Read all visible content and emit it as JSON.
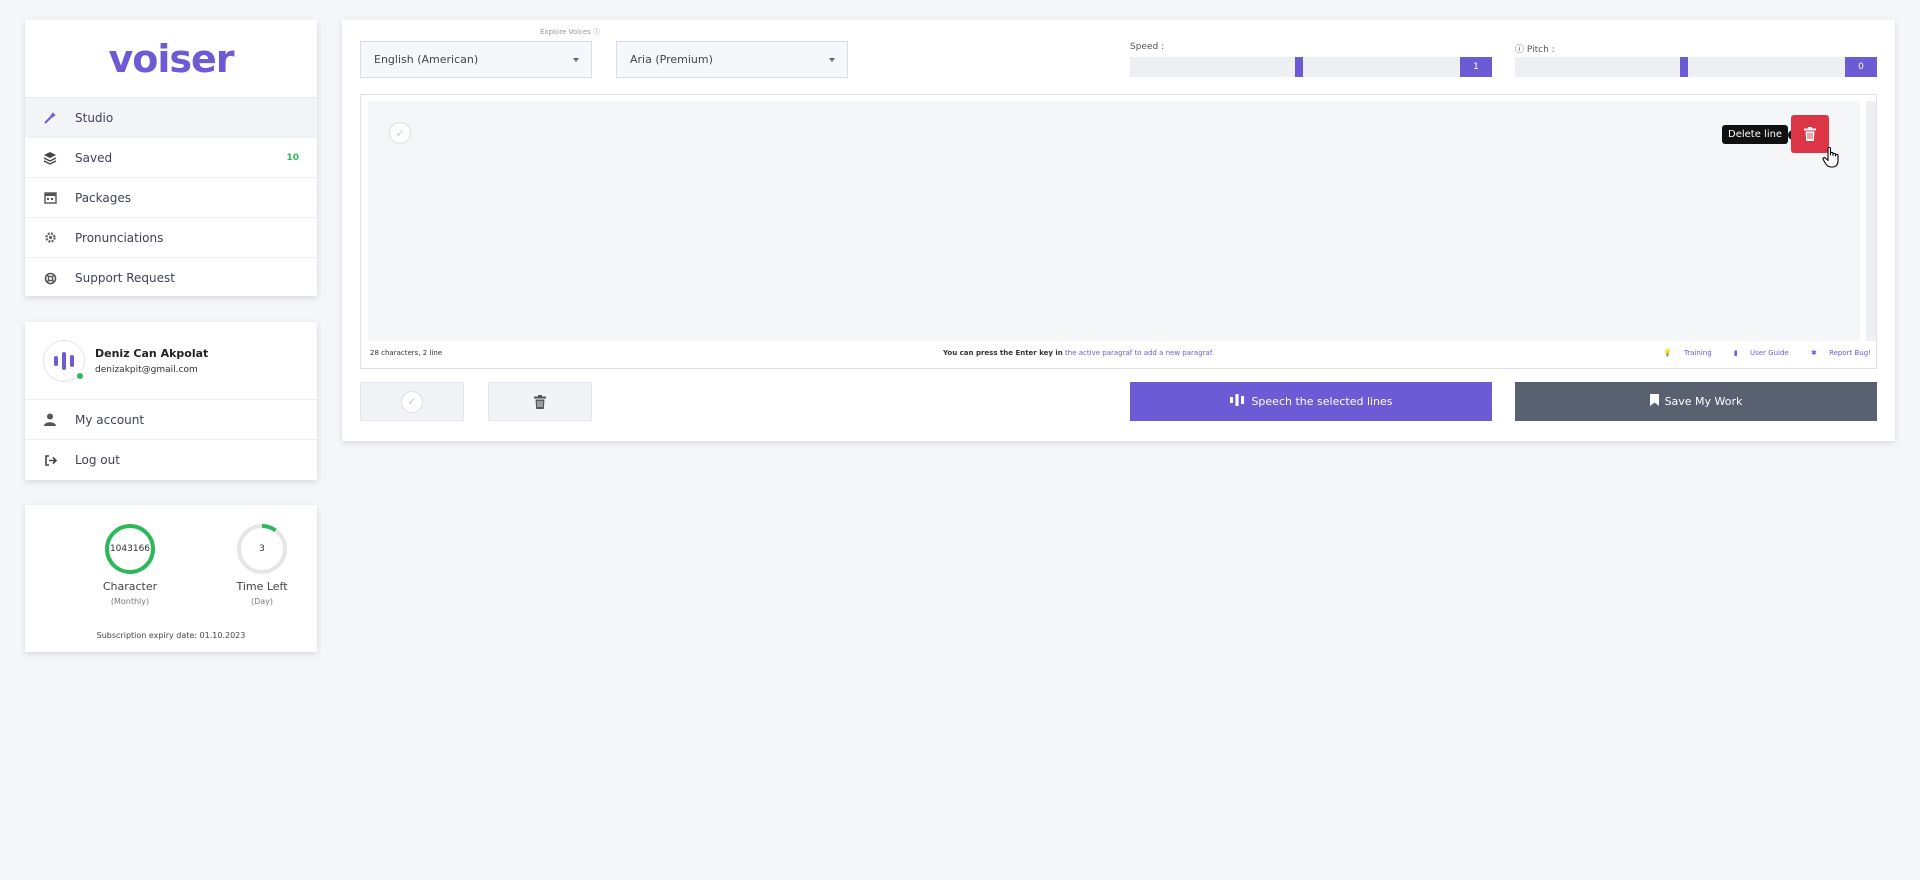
{
  "brand": {
    "logo_text": "voiser",
    "accent": "#6c5bd4"
  },
  "sidebar": {
    "items": [
      {
        "label": "Studio",
        "icon": "magic-wand-icon",
        "active": true
      },
      {
        "label": "Saved",
        "icon": "layers-icon",
        "badge": "10"
      },
      {
        "label": "Packages",
        "icon": "calendar-icon"
      },
      {
        "label": "Pronunciations",
        "icon": "gear-icon"
      },
      {
        "label": "Support Request",
        "icon": "lifebuoy-icon"
      }
    ]
  },
  "user": {
    "name": "Deniz Can Akpolat",
    "email": "denizakpit@gmail.com",
    "status": "online",
    "menu": [
      {
        "label": "My account",
        "icon": "user-icon"
      },
      {
        "label": "Log out",
        "icon": "logout-icon"
      }
    ]
  },
  "stats": {
    "character": {
      "value": "1043166",
      "label": "Character",
      "sub": "(Monthly)",
      "fill": 1.0
    },
    "time_left": {
      "value": "3",
      "label": "Time Left",
      "sub": "(Day)",
      "fill": 0.1
    },
    "expiry": "Subscription expiry date: 01.10.2023"
  },
  "toolbar": {
    "explore_voices": "Explore Voices",
    "language": "English (American)",
    "voice": "Aria (Premium)",
    "speed": {
      "label": "Speed :",
      "value": "1",
      "level": 0.5
    },
    "pitch": {
      "label": "Pitch :",
      "value": "0",
      "level": 0.5
    }
  },
  "editor": {
    "tooltip": "Delete line",
    "char_count": "28 characters, 2 line",
    "hint_pre": "You can press the Enter key in",
    "hint_link": "the active paragraf to add a new paragraf.",
    "links": [
      "Training",
      "User Guide",
      "Report Bug!"
    ]
  },
  "actions": {
    "speech": "Speech the selected lines",
    "save": "Save My Work"
  }
}
